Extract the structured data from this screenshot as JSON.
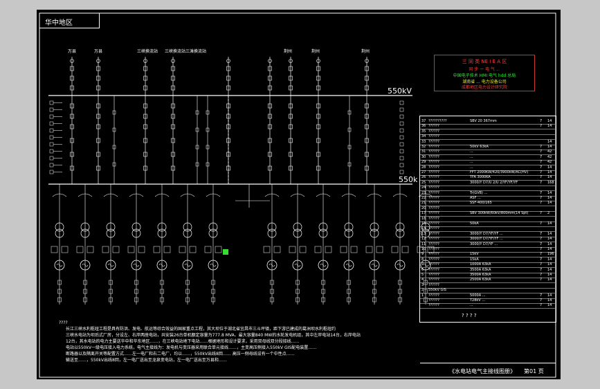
{
  "region_title": "华中地区",
  "bus_labels": {
    "upper": "550kV",
    "lower": "550k"
  },
  "feeders_left": [
    "万县",
    "万县",
    "三峡换流站",
    "三峡换流站三滩换流站"
  ],
  "feeders_right": [
    "荆州",
    "荆州",
    "荆州"
  ],
  "legend": {
    "lines": [
      "三 同 类   NE I E A 区",
      "同 步 一 电 气   ...",
      "中国电子技术 HMI 电气  hdd  总局",
      "湖南省 ... 电力设备公司",
      "成都地区电力设计研究院"
    ],
    "colors": {
      "line1": "#ff3b3b",
      "line2": "#ff3b3b",
      "line3": "#34e834",
      "line4": "#e8e834",
      "line5": "#ff3b3b"
    }
  },
  "table_rows": [
    {
      "n": "37",
      "name": "??????????",
      "spec": "SBV  20  367mm",
      "q": "7",
      "u": "14"
    },
    {
      "n": "36",
      "name": "??????",
      "spec": "",
      "q": "7",
      "u": "14"
    },
    {
      "n": "35",
      "name": "??????",
      "spec": "",
      "q": "",
      "u": ""
    },
    {
      "n": "34",
      "name": "??????",
      "spec": "",
      "q": "",
      "u": ""
    },
    {
      "n": "33",
      "name": "??????",
      "spec": "",
      "q": "",
      "u": "14"
    },
    {
      "n": "32",
      "name": "??????",
      "spec": "50kV  63kA",
      "q": "7",
      "u": "14"
    },
    {
      "n": "31",
      "name": "??????",
      "spec": "...",
      "q": "7",
      "u": "42"
    },
    {
      "n": "30",
      "name": "??????",
      "spec": "...",
      "q": "7",
      "u": "42"
    },
    {
      "n": "29",
      "name": "??????",
      "spec": "...",
      "q": "7",
      "u": "42"
    },
    {
      "n": "28",
      "name": "??????",
      "spec": "...",
      "q": "7",
      "u": "14"
    },
    {
      "n": "27",
      "name": "??????",
      "spec": "FFT 2000KW/420/3900kW/AC(HV)",
      "q": "7",
      "u": "14"
    },
    {
      "n": "26",
      "name": "??????",
      "spec": "TFA  3000KA",
      "q": "7",
      "u": "14"
    },
    {
      "n": "25",
      "name": "??????",
      "spec": "3000/Y D7/U 2/U 2/YF/YF/YF",
      "q": "7",
      "u": "168"
    },
    {
      "n": "24",
      "name": "??????",
      "spec": "",
      "q": "",
      "u": ""
    },
    {
      "n": "23",
      "name": "??????",
      "spec": "Tr(GVB) ...",
      "q": "7",
      "u": "14"
    },
    {
      "n": "22",
      "name": "??????",
      "spec": "ASF ...",
      "q": "7",
      "u": "14"
    },
    {
      "n": "21",
      "name": "??????",
      "spec": "SSF-400/165",
      "q": "7",
      "u": "14"
    },
    {
      "n": "20",
      "name": "??????",
      "spec": "",
      "q": "",
      "u": ""
    },
    {
      "n": "17",
      "name": "??????",
      "spec": "SBV  300kW/60kV/800mm(14 Spt)",
      "q": "7",
      "u": "2"
    },
    {
      "n": "16",
      "name": "??????",
      "spec": "",
      "q": "",
      "u": ""
    },
    {
      "n": "15",
      "name": "??????",
      "spec": "50kA",
      "q": "7",
      "u": "14"
    },
    {
      "n": "14",
      "name": "??????",
      "spec": "",
      "q": "",
      "u": ""
    },
    {
      "n": "13",
      "name": "??????",
      "spec": "3000/Y D7/YF/YF ...",
      "q": "7",
      "u": "14"
    },
    {
      "n": "12",
      "name": "??????",
      "spec": "3000/Y D7/YF/YF ...",
      "q": "7",
      "u": "14"
    },
    {
      "n": "11",
      "name": "??????",
      "spec": "3000/Y D7/YF ...",
      "q": "7",
      "u": "14"
    },
    {
      "n": "10",
      "name": "??????",
      "spec": "",
      "q": "7",
      "u": "14"
    },
    {
      "n": "9",
      "name": "??????",
      "spec": "15kV",
      "q": "7",
      "u": "196"
    },
    {
      "n": "8",
      "name": "??????",
      "spec": "15kA",
      "q": "7",
      "u": "14"
    },
    {
      "n": "7",
      "name": "??????",
      "spec": "1000A  63kA",
      "q": "7",
      "u": "14"
    },
    {
      "n": "6",
      "name": "??????",
      "spec": "3500A  63kA",
      "q": "7",
      "u": "14"
    },
    {
      "n": "5",
      "name": "??????",
      "spec": "3500A  63kA",
      "q": "7",
      "u": "14"
    },
    {
      "n": "4",
      "name": "??????",
      "spec": "2500A  63kA",
      "q": "7",
      "u": "14"
    },
    {
      "n": "3",
      "name": "??????",
      "spec": "",
      "q": "",
      "u": ""
    },
    {
      "n": "2",
      "name": "550kV  GIS",
      "spec": "",
      "q": "",
      "u": ""
    },
    {
      "n": "1",
      "name": "??????",
      "spec": "5000A  ...",
      "q": "7",
      "u": "14"
    },
    {
      "n": "",
      "name": "??????",
      "spec": "T28kV  ...",
      "q": "7",
      "u": "14"
    },
    {
      "n": "",
      "name": "??????",
      "spec": "...",
      "q": "7",
      "u": "14"
    }
  ],
  "table_footer": "? ? ? ?",
  "note_heading": "????",
  "notes": [
    "长江三峡水利枢纽工程是具有防洪、发电、航运等综合效益的国家重点工程，其大坝位于湖北省宜昌市三斗坪镇，距下游已建成的葛洲坝水利枢纽约",
    "三峡水电站为坝后式厂房，分设左、右岸两座电站，共安装26台单机额定容量为777.8 MVA、最大容量840 MW的水轮发电机组，其中左岸电站14台，右岸电站",
    "12台，其水电站的电力主要送华中和华东地区……，在三峡电站地下电站……根据地形和设计要求，采用双母线双分段接线……",
    "电站以550kV一级电压接入电力系统，电气主接线为：发电机与变压器采用联合单元接线……，主变高压侧接入550kV GIS配电装置……",
    "断路器以及隔离开关等配置方式……左一电厂和右二电厂，均以……，550kV出线8回…… 高压一侧母线设有一个中性点……",
    "输送至……，550kV出线8回，左一电厂送出至龙泉变电站，左一电厂送出至万县和……"
  ],
  "drawing_caption": "《水电站电气主接线图册》",
  "sheet_label": "第01 页",
  "highlight_color": "#33dd33",
  "line_color": "#ffffff"
}
